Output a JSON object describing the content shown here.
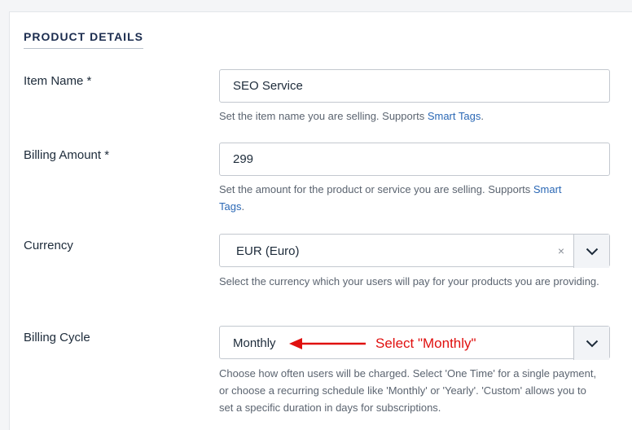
{
  "section": {
    "title": "PRODUCT DETAILS"
  },
  "item_name": {
    "label": "Item Name *",
    "value": "SEO Service",
    "help_text": "Set the item name you are selling. Supports ",
    "help_link": "Smart Tags",
    "help_suffix": "."
  },
  "billing_amount": {
    "label": "Billing Amount *",
    "value": "299",
    "help_text": "Set the amount for the product or service you are selling. Supports ",
    "help_link_1": "Smart",
    "help_link_2": "Tags",
    "help_suffix": "."
  },
  "currency": {
    "label": "Currency",
    "selected": "EUR (Euro)",
    "clear_glyph": "×",
    "help_text": "Select the currency which your users will pay for your products you are providing."
  },
  "billing_cycle": {
    "label": "Billing Cycle",
    "selected": "Monthly",
    "help_text": "Choose how often users will be charged. Select 'One Time' for a single payment, or choose a recurring schedule like 'Monthly' or 'Yearly'. 'Custom' allows you to set a specific duration in days for subscriptions."
  },
  "annotation": {
    "text": "Select \"Monthly\"",
    "color": "#e0100f"
  },
  "icons": {
    "dropdown": "chevron-down-icon",
    "clear": "close-icon",
    "arrow": "arrow-left-icon"
  }
}
